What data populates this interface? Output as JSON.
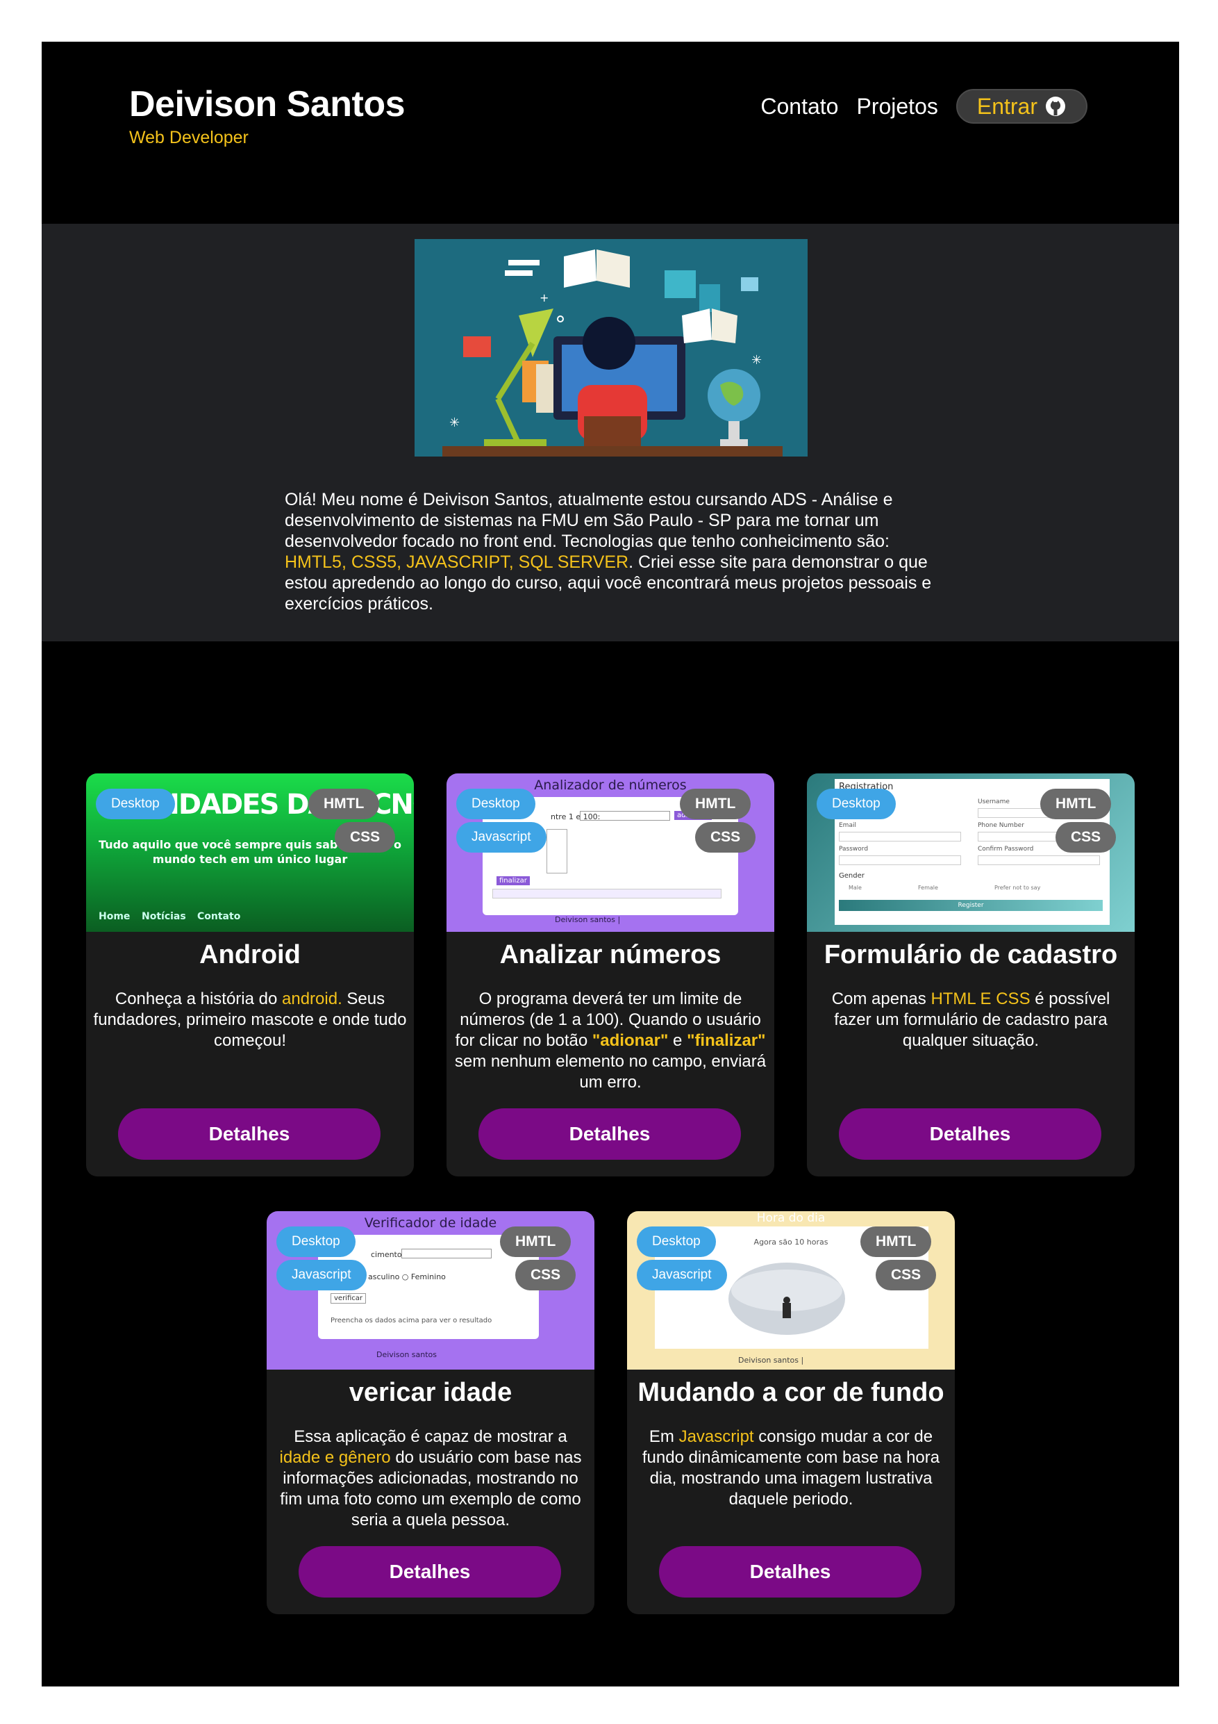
{
  "header": {
    "name": "Deivison Santos",
    "role": "Web Developer",
    "nav": {
      "contact": "Contato",
      "projects": "Projetos",
      "login": "Entrar"
    }
  },
  "bio": {
    "intro": "Olá! Meu nome é Deivison Santos, atualmente estou cursando ADS - Análise e desenvolvimento de sistemas na FMU em São Paulo - SP para me tornar um desenvolvedor focado no front end. Tecnologias que tenho conheicimento são:",
    "technologies": "HMTL5, CSS5, JAVASCRIPT, SQL SERVER",
    "outro": ". Criei esse site para demonstrar o que estou apredendo ao longo do curso, aqui você encontrará meus projetos pessoais e exercícios práticos."
  },
  "projects": [
    {
      "title": "Android",
      "desc_before": "Conheça a história do ",
      "desc_highlight": "android.",
      "desc_after": " Seus fundadores, primeiro mascote e onde tudo começou!",
      "tags": [
        "Desktop",
        "HMTL",
        "CSS"
      ],
      "button": "Detalhes",
      "preview": {
        "headline": "IDADES DA TECNOLOGIA",
        "subtitle": "Tudo aquilo que você sempre quis saber sobre o mundo tech em um único lugar",
        "nav": [
          "Home",
          "Notícias",
          "Contato"
        ]
      }
    },
    {
      "title": "Analizar números",
      "desc_before": "O programa deverá ter um limite de números (de 1 a 100). Quando o usuário for clicar no botão ",
      "desc_q1": "\"adionar\"",
      "desc_mid": " e ",
      "desc_q2": "\"finalizar\"",
      "desc_after": " sem nenhum elemento no campo, enviará um erro.",
      "tags": [
        "Desktop",
        "Javascript",
        "HMTL",
        "CSS"
      ],
      "button": "Detalhes",
      "preview": {
        "heading": "Analizador de números",
        "label": "ntre 1 e 100:",
        "add": "adicionar",
        "finish": "finalizar",
        "footer": "Deivison santos |"
      }
    },
    {
      "title": "Formulário de cadastro",
      "desc_before": "Com apenas ",
      "desc_highlight": "HTML E CSS",
      "desc_after": " é possível fazer um formulário de cadastro para qualquer situação.",
      "tags": [
        "Desktop",
        "HMTL",
        "CSS"
      ],
      "button": "Detalhes",
      "preview": {
        "heading": "Registration",
        "fields": [
          "Username",
          "Email",
          "Phone Number",
          "Password",
          "Confirm Password"
        ],
        "gender": "Gender",
        "genders": [
          "Male",
          "Female",
          "Prefer not to say"
        ],
        "submit": "Register"
      }
    },
    {
      "title": "vericar idade",
      "desc_before": "Essa aplicação é capaz de mostrar a ",
      "desc_highlight": "idade e gênero",
      "desc_after": " do usuário com base nas informações adicionadas, mostrando no fim uma foto como um exemplo de como seria a quela pessoa.",
      "tags": [
        "Desktop",
        "Javascript",
        "HMTL",
        "CSS"
      ],
      "button": "Detalhes",
      "preview": {
        "heading": "Verificador de idade",
        "birth": "cimento",
        "sex": "asculino ○ Feminino",
        "verify": "verificar",
        "hint": "Preencha os dados acima para ver o resultado",
        "footer": "Deivison santos"
      }
    },
    {
      "title": "Mudando a cor de fundo",
      "desc_before": "Em ",
      "desc_highlight": "Javascript",
      "desc_after": " consigo mudar a cor de fundo dinâmicamente com base na hora dia, mostrando uma imagem lustrativa daquele periodo.",
      "tags": [
        "Desktop",
        "Javascript",
        "HMTL",
        "CSS"
      ],
      "button": "Detalhes",
      "preview": {
        "heading": "Hora do dia",
        "time": "Agora são 10 horas",
        "footer": "Deivison santos |"
      }
    }
  ],
  "colors": {
    "accent": "#f4c21b",
    "button": "#7b0a86",
    "tag_blue": "#3fa5e6",
    "tag_gray": "#6b6b6b"
  }
}
